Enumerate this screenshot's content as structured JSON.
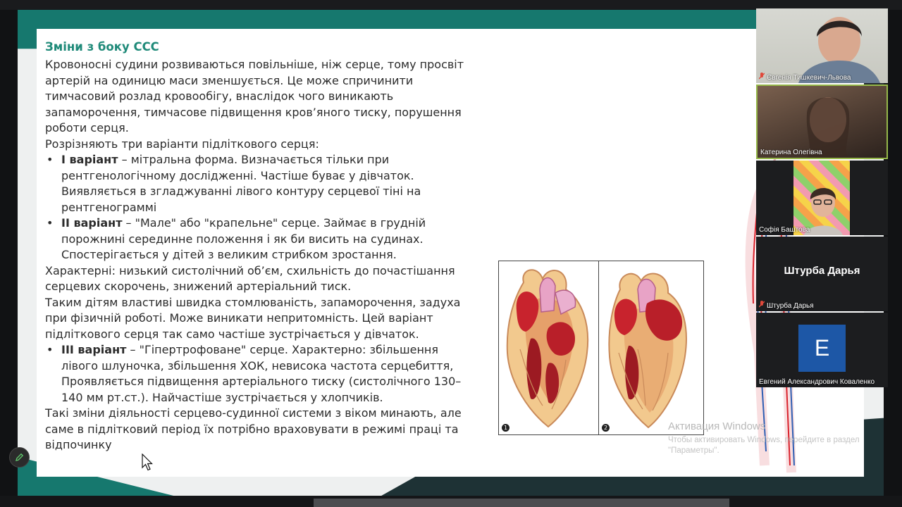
{
  "slide": {
    "title": "Зміни з боку ССС",
    "intro": [
      "Кровоносні судини розвиваються повільніше, ніж серце, тому просвіт",
      "артерій на одиницю маси зменшується. Це може спричинити",
      "тимчасовий розлад кровообігу, внаслідок чого виникають",
      "запаморочення, тимчасове підвищення кров’яного тиску, порушення",
      "роботи серця.",
      "Розрізняють три варіанти підліткового серця:"
    ],
    "variant1": {
      "label": "I варіант",
      "lines": [
        " – мітральна форма. Визначається тільки при",
        "рентгенологічному дослідженні. Частіше буває у дівчаток.",
        "Виявляється в згладжуванні лівого контуру серцевої тіні на",
        "рентгенограммі"
      ]
    },
    "variant2": {
      "label": "II варіант",
      "lines": [
        " – \"Мале\" або \"крапельне\" серце. Займає в грудній",
        "порожнині серединне положення і як би висить на судинах.",
        "Спостерігається у дітей з великим стрибком зростання."
      ]
    },
    "middle": [
      "Характерні: низький систолічний об’єм, схильність до почастішання",
      "серцевих скорочень, знижений артеріальний тиск.",
      "Таким дітям властиві швидка стомлюваність, запаморочення, задуха",
      "при фізичній роботі. Може виникати непритомність. Цей варіант",
      "підліткового серця так само частіше зустрічається у дівчаток."
    ],
    "variant3": {
      "label": "III варіант",
      "lines": [
        " – \"Гіпертрофоване\" серце. Характерно: збільшення",
        "лівого шлуночка, збільшення ХОК, невисока частота серцебиття,",
        "Проявляється підвищення артеріального тиску (систолічного 130–",
        "140 мм рт.ст.). Найчастіше зустрічається у хлопчиків."
      ]
    },
    "outro": [
      "Такі зміни діяльності серцево-судинної системи з віком минають, але",
      "саме в підлітковий період їх потрібно враховувати в режимі праці та",
      "відпочинку"
    ],
    "figure_labels": [
      "1",
      "2"
    ]
  },
  "watermark": {
    "title": "Активация Windows",
    "line1": "Чтобы активировать Windows, перейдите в раздел",
    "line2": "\"Параметры\"."
  },
  "participants": [
    {
      "name": "Євгенія Тишкевич-Львова",
      "muted": true,
      "video": true
    },
    {
      "name": "Катерина Олегівна",
      "muted": false,
      "video": true,
      "active_speaker": true
    },
    {
      "name": "Софія Баштова",
      "muted": false,
      "video": true
    },
    {
      "name": "Штурба Дарья",
      "display": "Штурба Дарья",
      "muted": true,
      "video": false
    },
    {
      "name": "Евгений Александрович Коваленко",
      "initial": "E",
      "muted": false,
      "video": false,
      "avatar_color": "#1d57a6"
    }
  ],
  "colors": {
    "title_teal": "#1f8a79",
    "share_teal": "#16786e",
    "active_speaker_border": "#96b84a",
    "mute_red": "#e0483a"
  },
  "icons": [
    "mic-muted-icon",
    "pencil-icon",
    "mouse-cursor-icon"
  ]
}
